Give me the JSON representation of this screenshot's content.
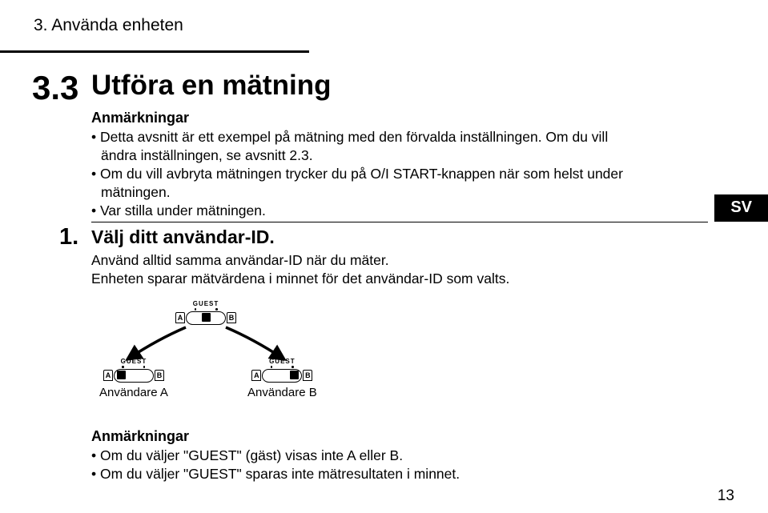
{
  "chapter": {
    "title": "3. Använda enheten"
  },
  "section": {
    "number": "3.3",
    "title": "Utföra en mätning"
  },
  "notes1": {
    "heading": "Anmärkningar",
    "b1": "• Detta avsnitt är ett exempel på mätning med den förvalda inställningen. Om du vill ändra inställningen, se avsnitt 2.3.",
    "b2": "• Om du vill avbryta mätningen trycker du på O/I START-knappen när som helst under mätningen.",
    "b3": "• Var stilla under mätningen."
  },
  "langTab": "SV",
  "step": {
    "number": "1.",
    "title": "Välj ditt användar-ID.",
    "line1": "Använd alltid samma användar-ID när du mäter.",
    "line2": "Enheten sparar mätvärdena i minnet för det användar-ID som valts."
  },
  "switch": {
    "guest": "GUEST",
    "a": "A",
    "b": "B",
    "userA": "Användare A",
    "userB": "Användare B"
  },
  "notes2": {
    "heading": "Anmärkningar",
    "b1": "• Om du väljer \"GUEST\" (gäst) visas inte A eller B.",
    "b2": "• Om du väljer \"GUEST\" sparas inte mätresultaten i minnet."
  },
  "pageNumber": "13"
}
